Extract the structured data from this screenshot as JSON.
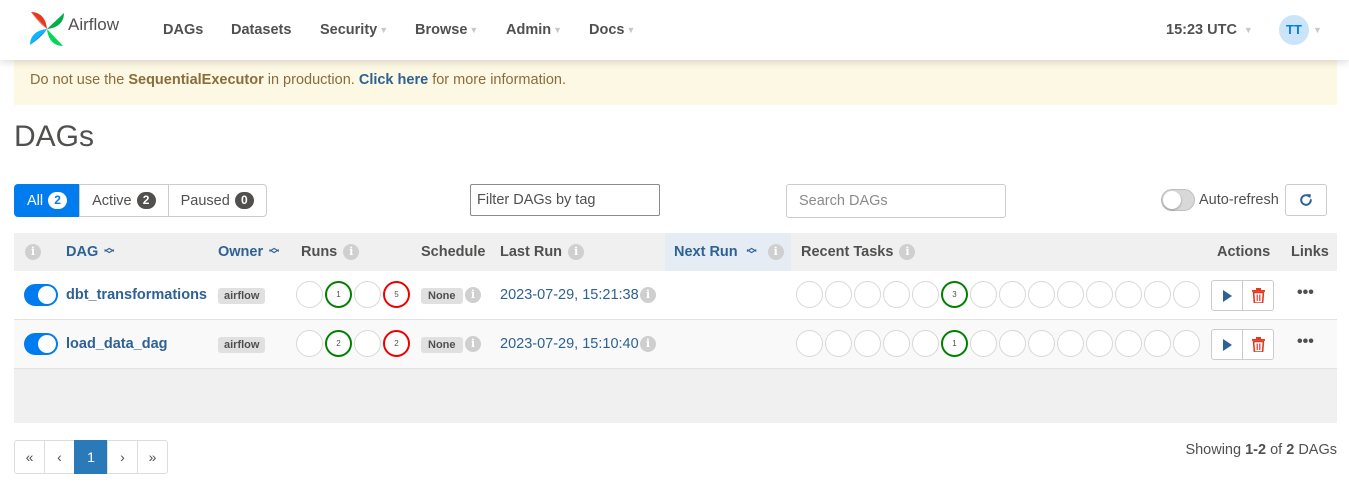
{
  "nav": {
    "brand": "Airflow",
    "items": [
      {
        "label": "DAGs",
        "dropdown": false
      },
      {
        "label": "Datasets",
        "dropdown": false
      },
      {
        "label": "Security",
        "dropdown": true
      },
      {
        "label": "Browse",
        "dropdown": true
      },
      {
        "label": "Admin",
        "dropdown": true
      },
      {
        "label": "Docs",
        "dropdown": true
      }
    ],
    "clock": "15:23 UTC",
    "user_initials": "TT"
  },
  "banner": {
    "prefix": "Do not use the ",
    "executor": "SequentialExecutor",
    "middle": " in production. ",
    "link": "Click here",
    "suffix": " for more information."
  },
  "page_title": "DAGs",
  "filters": {
    "all": {
      "label": "All",
      "count": "2"
    },
    "active": {
      "label": "Active",
      "count": "2"
    },
    "paused": {
      "label": "Paused",
      "count": "0"
    },
    "tag_placeholder": "Filter DAGs by tag",
    "search_placeholder": "Search DAGs",
    "auto_refresh_label": "Auto-refresh"
  },
  "columns": {
    "dag": "DAG",
    "owner": "Owner",
    "runs": "Runs",
    "schedule": "Schedule",
    "last_run": "Last Run",
    "next_run": "Next Run",
    "recent_tasks": "Recent Tasks",
    "actions": "Actions",
    "links": "Links"
  },
  "dags": [
    {
      "name": "dbt_transformations",
      "owner": "airflow",
      "runs": [
        "",
        "1",
        "",
        "5"
      ],
      "schedule": "None",
      "last_run": "2023-07-29, 15:21:38",
      "recent_tasks_success": "3"
    },
    {
      "name": "load_data_dag",
      "owner": "airflow",
      "runs": [
        "",
        "2",
        "",
        "2"
      ],
      "schedule": "None",
      "last_run": "2023-07-29, 15:10:40",
      "recent_tasks_success": "1"
    }
  ],
  "colors": {
    "primary": "#017cee",
    "link": "#2e6194",
    "success": "#008000",
    "failed": "#ee0000",
    "warning_bg": "#fcf8e3"
  },
  "pagination": {
    "first": "«",
    "prev": "‹",
    "current": "1",
    "next": "›",
    "last": "»"
  },
  "showing": {
    "prefix": "Showing ",
    "range": "1-2",
    "of": " of ",
    "total": "2",
    "suffix": " DAGs"
  }
}
